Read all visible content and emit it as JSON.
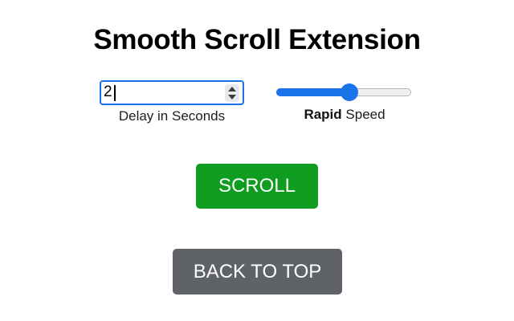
{
  "title": "Smooth Scroll Extension",
  "delay": {
    "value": "2",
    "label": "Delay in Seconds"
  },
  "speed": {
    "level_fraction": 0.55,
    "label_bold": "Rapid",
    "label_rest": " Speed"
  },
  "buttons": {
    "scroll_label": "SCROLL",
    "back_to_top_label": "BACK TO TOP"
  },
  "colors": {
    "accent": "#1a73e8",
    "scroll_button": "#0f9d20",
    "back_to_top_button": "#5f6368"
  }
}
